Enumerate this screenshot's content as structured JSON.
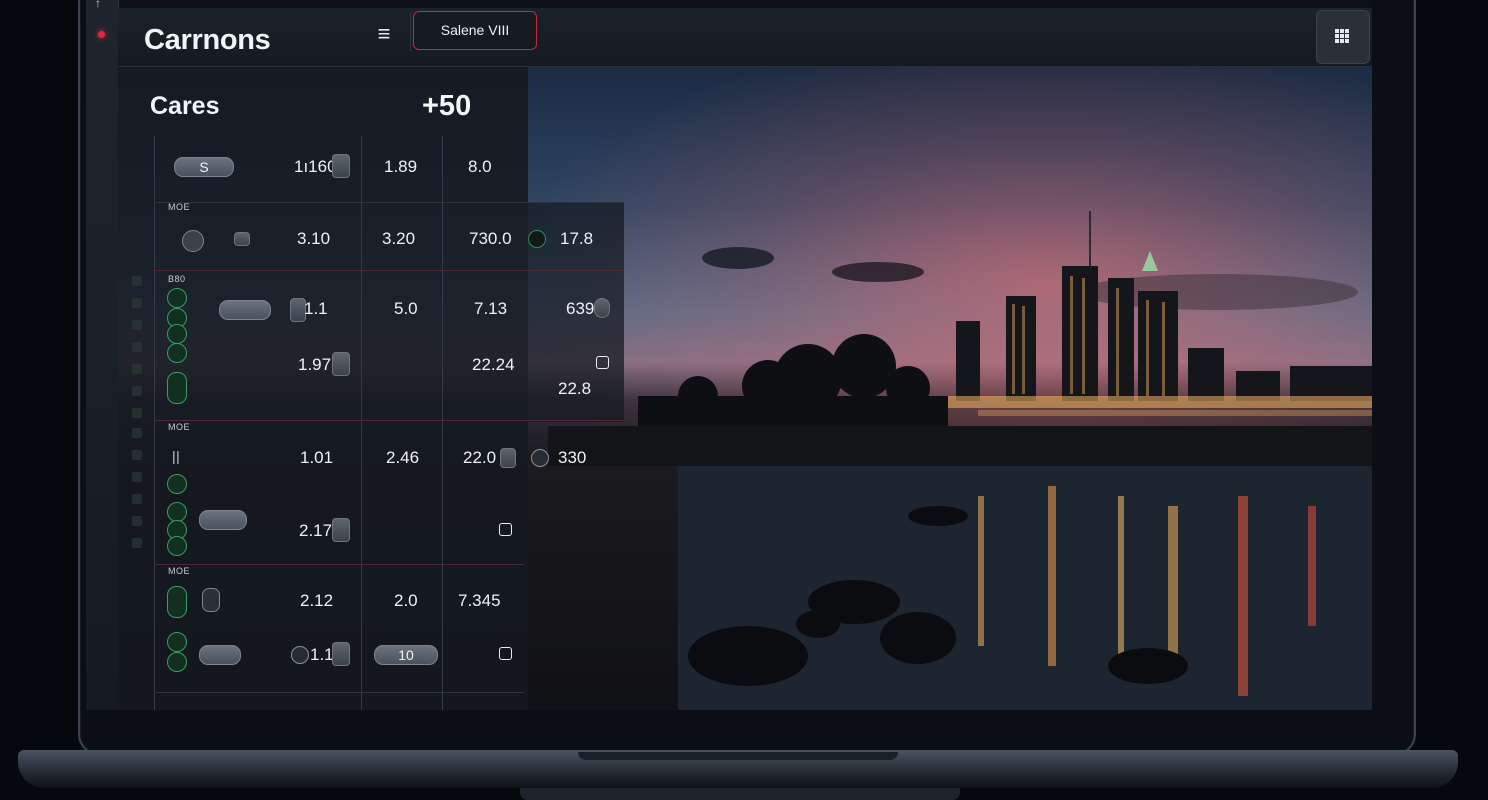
{
  "app": {
    "title": "Carrnons"
  },
  "toolbar": {
    "selector_label": "Salene    VIII"
  },
  "section": {
    "title": "Cares",
    "count": "+50"
  },
  "table": {
    "row1": {
      "pill": "S",
      "c2": "1ı160",
      "c3": "1.89",
      "c4": "8.0"
    },
    "group1_label": "MOE",
    "row2": {
      "c2": "3.10",
      "c3": "3.20",
      "c4": "730.0",
      "c5": "17.8"
    },
    "group2_label": "B80",
    "row3": {
      "c2": "1.1",
      "c3": "5.0",
      "c4": "7.13",
      "c5": "639"
    },
    "row4": {
      "c2": "1.97",
      "c4": "22.24",
      "c5b": "22.8"
    },
    "group3_label": "MOE",
    "row5": {
      "c2": "1.01",
      "c3": "2.46",
      "c4": "22.0",
      "c5": "330"
    },
    "row6": {
      "c2": "2.17"
    },
    "group4_label": "MOE",
    "row7": {
      "c2": "2.12",
      "c3": "2.0",
      "c4": "7.345"
    },
    "row8": {
      "c2": "1.1",
      "c3_pill": "10"
    }
  },
  "colors": {
    "accent_red": "#c8283a",
    "status_green": "#3a9a64"
  },
  "icons": [
    "menu-icon",
    "grid-icon"
  ]
}
